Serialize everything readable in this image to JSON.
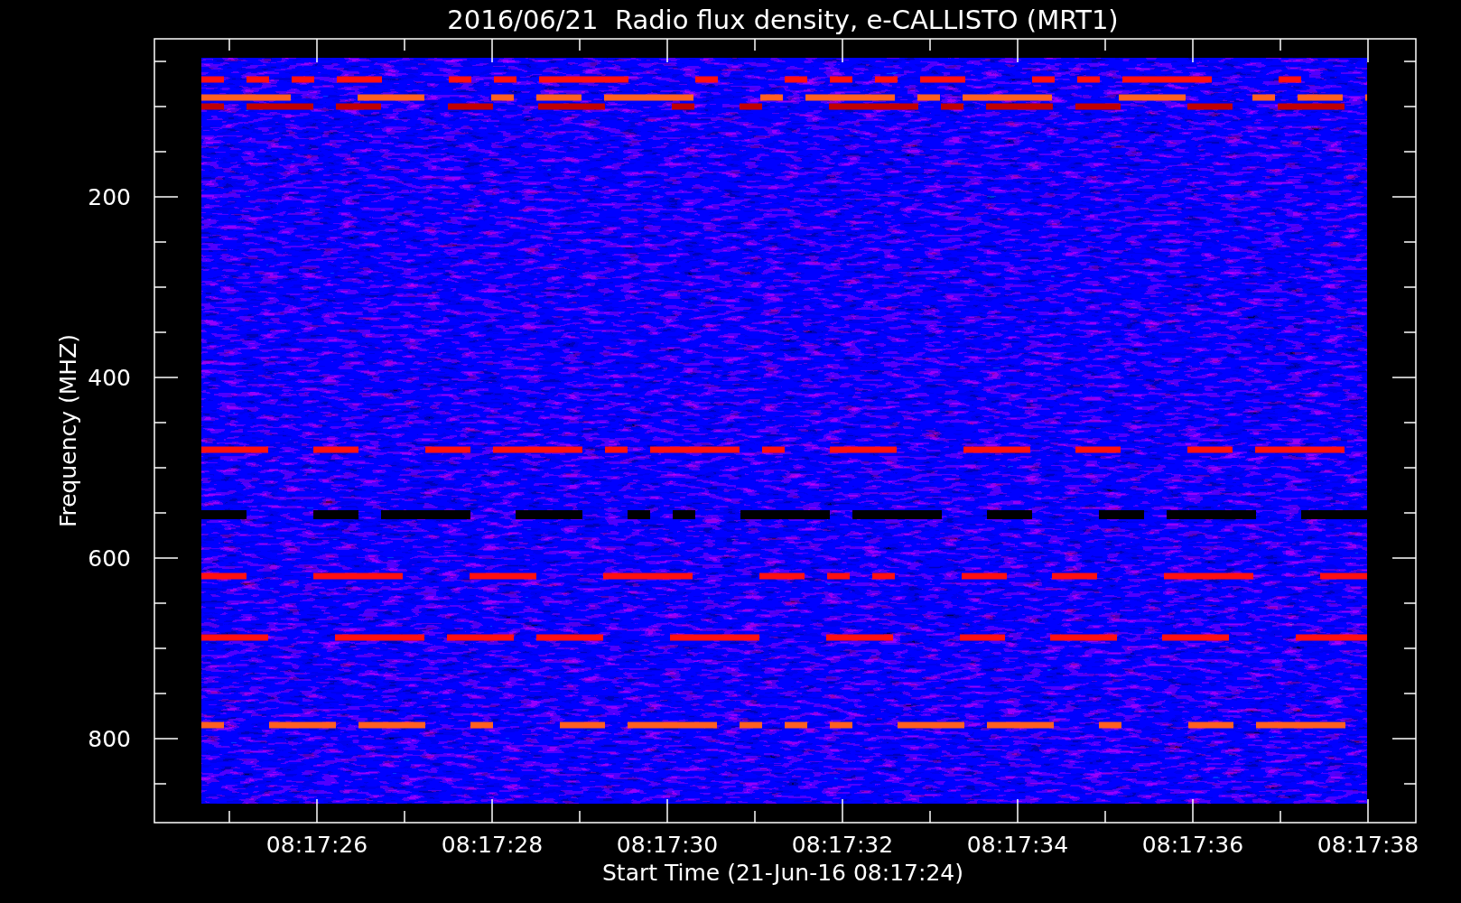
{
  "chart": {
    "title": "2016/06/21  Radio flux density, e-CALLISTO (MRT1)",
    "ylabel": "Frequency (MHZ)",
    "xlabel": "Start Time (21-Jun-16 08:17:24)",
    "ytick_labels": [
      "200",
      "400",
      "600",
      "800"
    ],
    "xtick_labels": [
      "08:17:26",
      "08:17:28",
      "08:17:30",
      "08:17:32",
      "08:17:34",
      "08:17:36",
      "08:17:38"
    ]
  }
}
